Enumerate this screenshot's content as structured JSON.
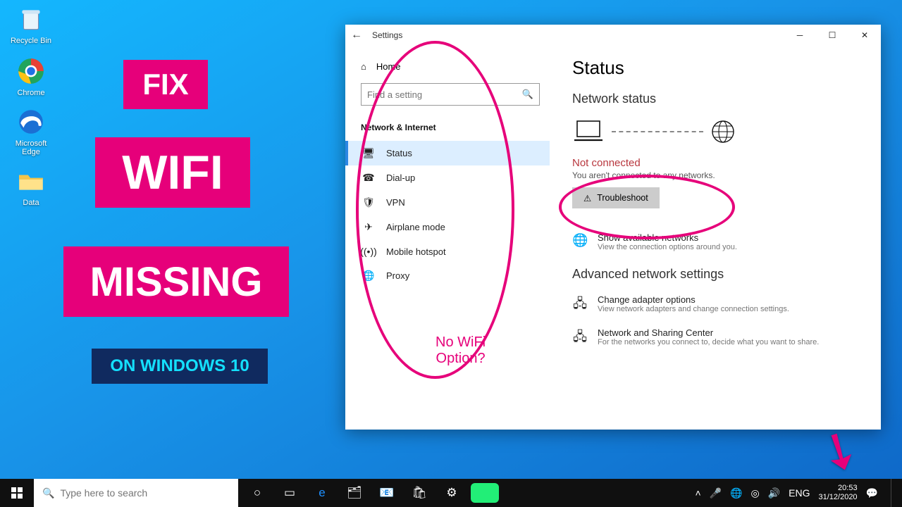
{
  "desktop": {
    "icons": [
      {
        "label": "Recycle Bin"
      },
      {
        "label": "Chrome"
      },
      {
        "label": "Microsoft Edge"
      },
      {
        "label": "Data"
      }
    ]
  },
  "promo": {
    "line1": "FIX",
    "line2": "WIFI",
    "line3": "MISSING",
    "line4": "ON WINDOWS 10"
  },
  "settings": {
    "title": "Settings",
    "home": "Home",
    "search_placeholder": "Find a setting",
    "section": "Network & Internet",
    "menu": [
      {
        "label": "Status",
        "icon": "status"
      },
      {
        "label": "Dial-up",
        "icon": "dialup"
      },
      {
        "label": "VPN",
        "icon": "vpn"
      },
      {
        "label": "Airplane mode",
        "icon": "airplane"
      },
      {
        "label": "Mobile hotspot",
        "icon": "hotspot"
      },
      {
        "label": "Proxy",
        "icon": "globe"
      }
    ],
    "status": {
      "heading": "Status",
      "network_status": "Network status",
      "not_connected": "Not connected",
      "not_connected_desc": "You aren't connected to any networks.",
      "troubleshoot": "Troubleshoot",
      "show_networks": "Show available networks",
      "show_networks_desc": "View the connection options around you.",
      "advanced": "Advanced network settings",
      "adapter": "Change adapter options",
      "adapter_desc": "View network adapters and change connection settings.",
      "sharing": "Network and Sharing Center",
      "sharing_desc": "For the networks you connect to, decide what you want to share."
    }
  },
  "annotation": {
    "no_wifi": "No WiFi\nOption?"
  },
  "taskbar": {
    "search_placeholder": "Type here to search",
    "lang": "ENG",
    "time": "20:53",
    "date": "31/12/2020"
  }
}
